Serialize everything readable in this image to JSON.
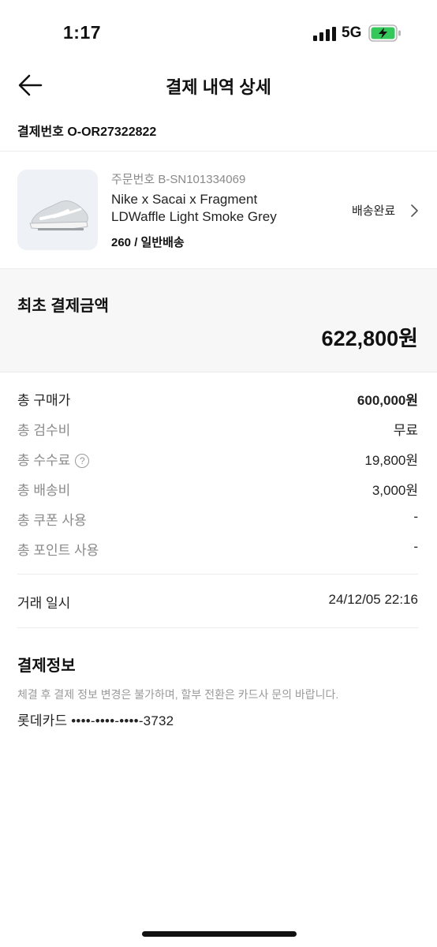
{
  "status_bar": {
    "time": "1:17",
    "network": "5G"
  },
  "header": {
    "title": "결제 내역 상세"
  },
  "payment_number": "결제번호 O-OR27322822",
  "product": {
    "order_number": "주문번호 B-SN101334069",
    "name_line1": "Nike x Sacai x Fragment",
    "name_line2": "LDWaffle Light Smoke Grey",
    "size_shipping": "260 / 일반배송",
    "status": "배송완료"
  },
  "total": {
    "label": "최초 결제금액",
    "amount": "622,800원"
  },
  "breakdown": [
    {
      "label": "총 구매가",
      "value": "600,000원"
    },
    {
      "label": "총 검수비",
      "value": "무료"
    },
    {
      "label": "총 수수료",
      "value": "19,800원"
    },
    {
      "label": "총 배송비",
      "value": "3,000원"
    },
    {
      "label": "총 쿠폰 사용",
      "value": "-"
    },
    {
      "label": "총 포인트 사용",
      "value": "-"
    }
  ],
  "transaction": {
    "label": "거래 일시",
    "value": "24/12/05 22:16"
  },
  "payment_info": {
    "title": "결제정보",
    "note": "체결 후 결제 정보 변경은 불가하며, 할부 전환은 카드사 문의 바랍니다.",
    "card": "롯데카드 ••••-••••-••••-3732"
  },
  "icons": {
    "back": "arrow-left-icon",
    "help": "question-circle-icon",
    "status": "chevron-right-icon",
    "battery": "battery-charging-icon",
    "signal": "signal-bars-icon"
  },
  "colors": {
    "battery_fill": "#34c759",
    "muted_text": "#8a8a8a",
    "total_bg": "#f7f7f7"
  }
}
